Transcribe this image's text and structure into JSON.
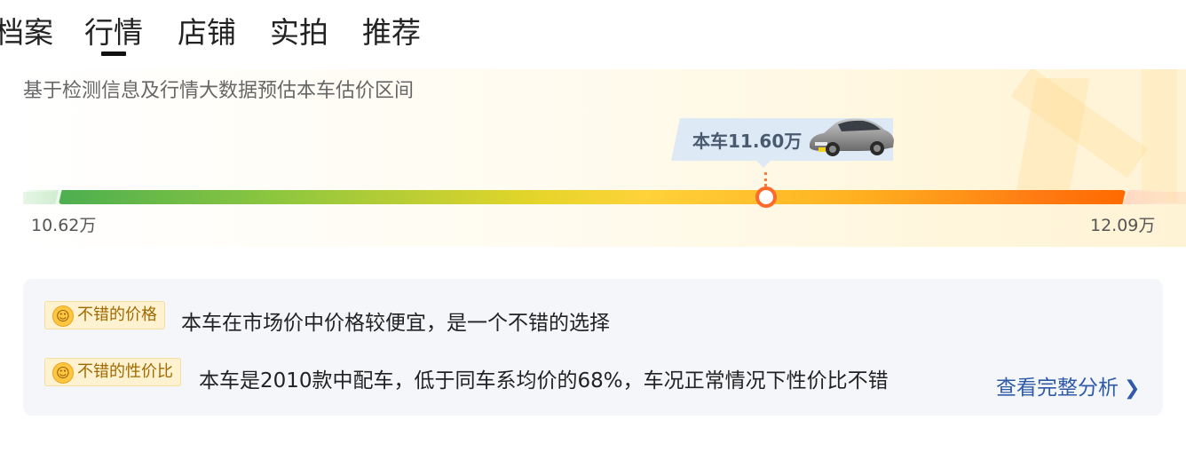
{
  "tabs": [
    {
      "label": "档案"
    },
    {
      "label": "行情"
    },
    {
      "label": "店铺"
    },
    {
      "label": "实拍"
    },
    {
      "label": "推荐"
    }
  ],
  "active_tab": "行情",
  "price_range": {
    "subtitle": "基于检测信息及行情大数据预估本车估价区间",
    "current_label": "本车11.60万",
    "min_label": "10.62万",
    "max_label": "12.09万",
    "min": 10.62,
    "max": 12.09,
    "current": 11.6
  },
  "analysis": {
    "rows": [
      {
        "tag": "不错的价格",
        "text": "本车在市场价中价格较便宜，是一个不错的选择",
        "icon": "smile-icon"
      },
      {
        "tag": "不错的性价比",
        "text": "本车是2010款中配车，低于同车系均价的68%，车况正常情况下性价比不错",
        "icon": "smile-icon"
      }
    ],
    "more_link": "查看完整分析",
    "more_icon": "chevron-right-icon"
  },
  "colors": {
    "marker": "#ff6a2c",
    "bar_start": "#4caf50",
    "bar_mid": "#ffd23a",
    "bar_end": "#ff6a00",
    "link": "#2f5aa8",
    "tag_bg": "#fff2d1",
    "tag_text": "#a06a00"
  }
}
